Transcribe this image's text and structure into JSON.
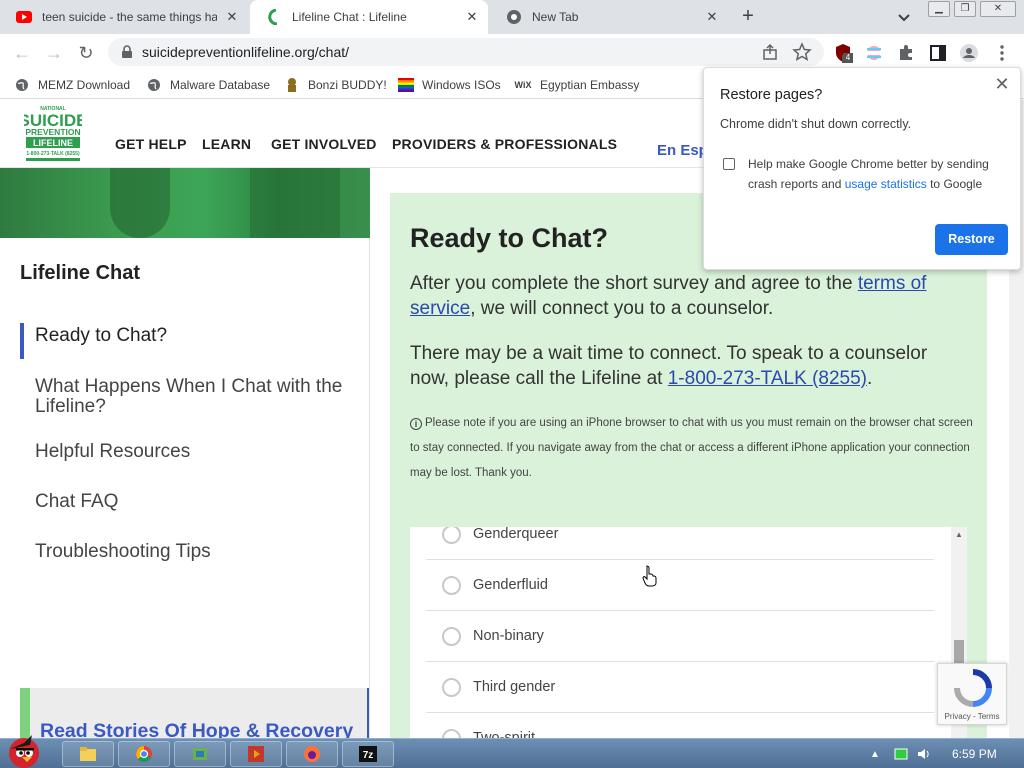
{
  "tabs": [
    {
      "title": "teen suicide - the same things ha",
      "favicon": "youtube-icon"
    },
    {
      "title": "Lifeline Chat : Lifeline",
      "favicon": "lifeline-icon"
    },
    {
      "title": "New Tab",
      "favicon": "chrome-icon"
    }
  ],
  "toolbar": {
    "url": "suicidepreventionlifeline.org/chat/",
    "extension_badge": "4"
  },
  "bookmarks": [
    {
      "label": "MEMZ Download",
      "icon": "globe-icon"
    },
    {
      "label": "Malware Database",
      "icon": "globe-icon"
    },
    {
      "label": "Bonzi BUDDY!",
      "icon": "bonzi-icon"
    },
    {
      "label": "Windows ISOs",
      "icon": "windows-flag-icon"
    },
    {
      "label": "Egyptian Embassy",
      "icon": "wix-icon"
    }
  ],
  "site": {
    "logo_lines": [
      "NATIONAL",
      "SUICIDE",
      "PREVENTION",
      "LIFELINE",
      "1-800-273-TALK (8255)"
    ],
    "nav": [
      "GET HELP",
      "LEARN",
      "GET INVOLVED",
      "PROVIDERS & PROFESSIONALS"
    ],
    "lang": "En Esp"
  },
  "sidebar": {
    "title": "Lifeline Chat",
    "items": [
      "Ready to Chat?",
      "What Happens When I Chat with the Lifeline?",
      "Helpful Resources",
      "Chat FAQ",
      "Troubleshooting Tips"
    ],
    "cta": "Read Stories Of Hope & Recovery"
  },
  "main": {
    "heading": "Ready to Chat?",
    "p1_before": "After you complete the short survey and agree to the ",
    "p1_link": "terms of service",
    "p1_after": ", we will connect you to a counselor.",
    "p2_before": "There may be a wait time to connect. To speak to a counselor now, please call the Lifeline at ",
    "p2_link": "1-800-273-TALK (8255)",
    "p2_after": ".",
    "note": "Please note if you are using an iPhone browser to chat with us you must remain on the browser chat screen to stay connected. If you navigate away from the chat or access a different iPhone application your connection may be lost. Thank you.",
    "options": [
      "Genderqueer",
      "Genderfluid",
      "Non-binary",
      "Third gender",
      "Two-spirit"
    ]
  },
  "recaptcha": {
    "label": "Privacy - Terms"
  },
  "restore": {
    "title": "Restore pages?",
    "message": "Chrome didn't shut down correctly.",
    "checkbox_before": "Help make Google Chrome better by sending crash reports and ",
    "checkbox_link": "usage statistics",
    "checkbox_after": " to Google",
    "button": "Restore"
  },
  "taskbar": {
    "time": "6:59 PM"
  }
}
